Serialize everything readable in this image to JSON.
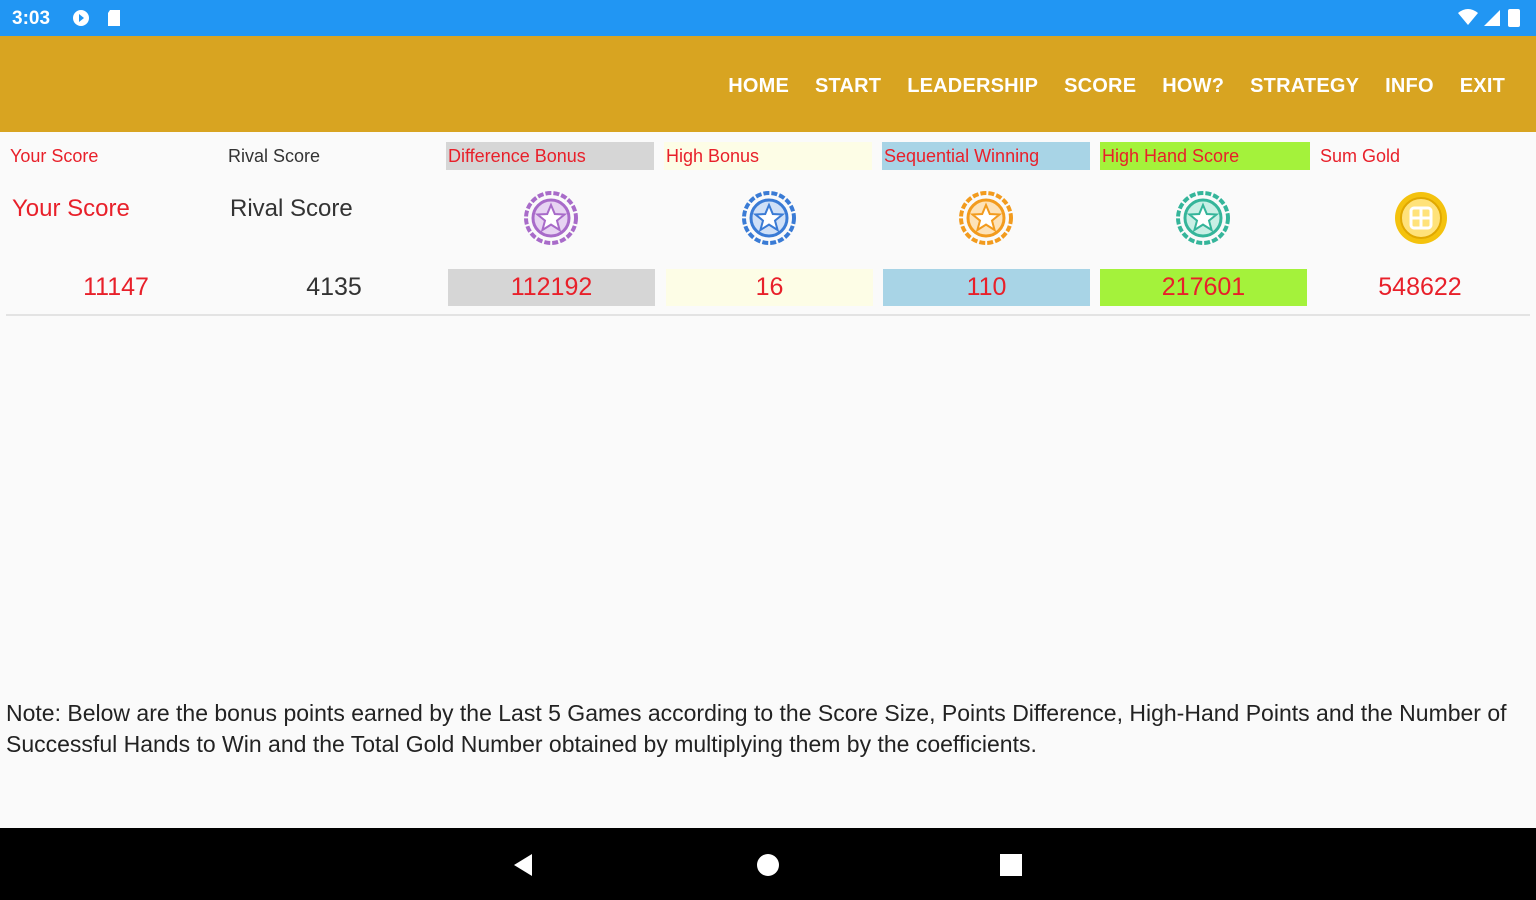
{
  "status_bar": {
    "time": "3:03",
    "icons_left": [
      "media-icon",
      "sd-card-icon"
    ],
    "icons_right": [
      "wifi-icon",
      "signal-icon",
      "battery-icon"
    ]
  },
  "nav": {
    "items": [
      "HOME",
      "START",
      "LEADERSHIP",
      "SCORE",
      "HOW?",
      "STRATEGY",
      "INFO",
      "EXIT"
    ]
  },
  "score_table": {
    "columns": [
      {
        "label": "Your Score",
        "heading": "Your Score",
        "value": "11147",
        "label_color": "#e8202a",
        "label_bg": "",
        "value_bg": ""
      },
      {
        "label": "Rival Score",
        "heading": "Rival Score",
        "value": "4135",
        "label_color": "#333333",
        "label_bg": "",
        "value_bg": ""
      },
      {
        "label": "Difference Bonus",
        "value": "112192",
        "medal": "purple-star-medal-icon",
        "medal_color": "#a86bc9",
        "label_color": "#e8202a",
        "label_bg": "#d6d6d6",
        "value_bg": "#d6d6d6"
      },
      {
        "label": "High Bonus",
        "value": "16",
        "medal": "blue-star-medal-icon",
        "medal_color": "#3a7bd5",
        "label_color": "#e8202a",
        "label_bg": "#fdfde6",
        "value_bg": "#fdfde6"
      },
      {
        "label": "Sequential Winning",
        "value": "110",
        "medal": "orange-star-medal-icon",
        "medal_color": "#f29b1e",
        "label_color": "#e8202a",
        "label_bg": "#a8d4e6",
        "value_bg": "#a8d4e6"
      },
      {
        "label": "High Hand Score",
        "value": "217601",
        "medal": "teal-star-medal-icon",
        "medal_color": "#35b59a",
        "label_color": "#e8202a",
        "label_bg": "#a4f23b",
        "value_bg": "#a4f23b"
      },
      {
        "label": "Sum Gold",
        "value": "548622",
        "medal": "gold-coin-icon",
        "medal_color": "#f4c20d",
        "label_color": "#e8202a",
        "label_bg": "",
        "value_bg": ""
      }
    ]
  },
  "note": "Note: Below are the bonus points earned by the Last 5 Games according to the Score Size, Points Difference, High-Hand Points and the Number of Successful Hands to Win and the Total Gold Number obtained by multiplying them by the coefficients.",
  "colors": {
    "status_bar": "#2196f3",
    "app_bar": "#d8a421",
    "accent_red": "#e8202a"
  }
}
